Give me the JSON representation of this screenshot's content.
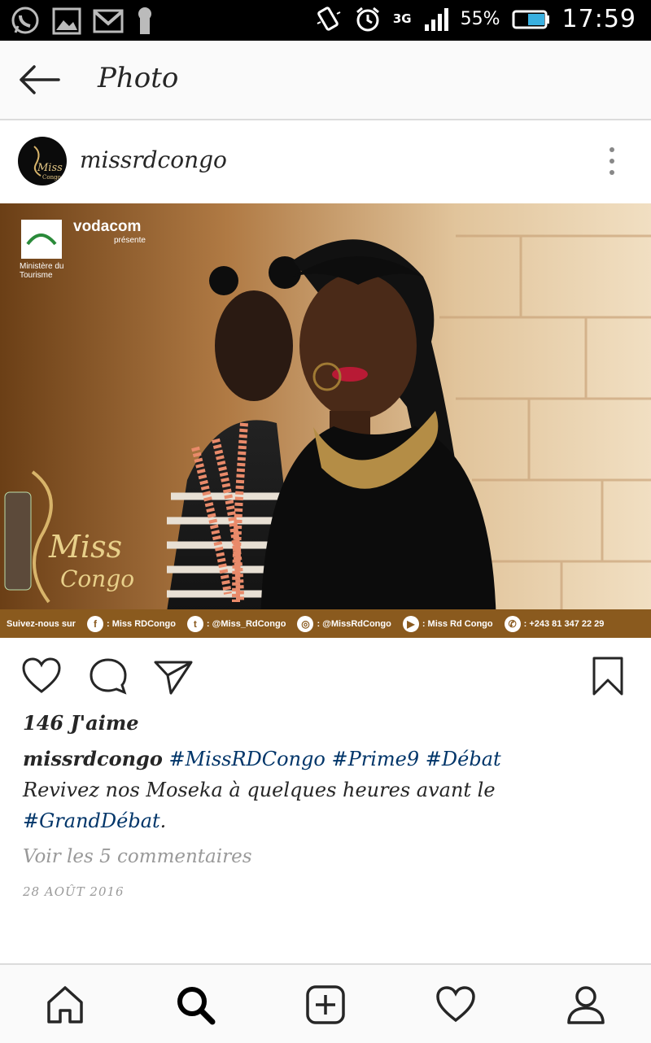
{
  "status_bar": {
    "battery_percent": "55%",
    "network": "3G",
    "time": "17:59",
    "icons": [
      "whatsapp-icon",
      "gallery-icon",
      "gmail-icon",
      "keyhole-icon",
      "vibrate-icon",
      "alarm-icon",
      "signal-icon",
      "battery-icon"
    ]
  },
  "header": {
    "title": "Photo"
  },
  "post": {
    "username": "missrdcongo",
    "image": {
      "ministry_label": "Ministère du Tourisme",
      "brand": "vodacom",
      "brand_sub": "présente",
      "logo_text_1": "Miss",
      "logo_text_2": "Congo",
      "footer_follow": "Suivez-nous sur",
      "footer_facebook": ": Miss RDCongo",
      "footer_twitter": ": @Miss_RdCongo",
      "footer_instagram": ": @MissRdCongo",
      "footer_youtube": ": Miss Rd Congo",
      "footer_whatsapp": ": +243 81 347 22 29",
      "colors": {
        "strip": "#8a5a1e",
        "wall": "#c9a274"
      }
    },
    "likes": "146 J'aime",
    "caption": {
      "user": "missrdcongo",
      "tag1": "#MissRDCongo",
      "tag2": "#Prime9",
      "tag3": "#Débat",
      "text": "Revivez nos Moseka à quelques heures avant le",
      "tag4": "#GrandDébat",
      "end": "."
    },
    "view_comments": "Voir les 5 commentaires",
    "date": "28 AOÛT 2016"
  },
  "colors": {
    "hashtag": "#003569",
    "muted": "#999999",
    "text": "#262626"
  }
}
